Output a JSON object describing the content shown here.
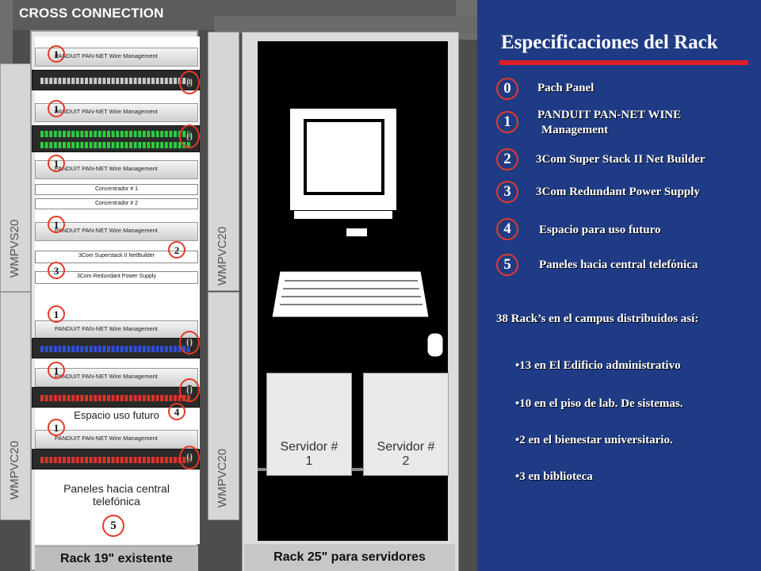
{
  "diagram": {
    "title": "CROSS CONNECTION",
    "pillar_labels": [
      "WMPVS20",
      "WMPVC20",
      "WMPVC20",
      "WMPVC20"
    ],
    "rack19": {
      "wire_mgmt_label": "PANDUIT PAN-NET Wire Management",
      "concentrators": [
        "Concentrador # 1",
        "Concentrador # 2"
      ],
      "net_builder": "3Com Superstack II NetBuilder",
      "power_supply": "3Com Redundant Power Supply",
      "future_space": "Espacio uso futuro",
      "phone_panels": "Paneles hacia central telefónica",
      "label": "Rack 19\" existente"
    },
    "rack25": {
      "label": "Rack 25\" para servidores",
      "servers": [
        {
          "line1": "Servidor #",
          "line2": "1"
        },
        {
          "line1": "Servidor #",
          "line2": "2"
        }
      ]
    },
    "markers": {
      "one": "1",
      "zero": "0",
      "two": "2",
      "three": "3",
      "four": "4",
      "five": "5"
    }
  },
  "specs": {
    "title": "Especificaciones del Rack",
    "legend": [
      {
        "num": "0",
        "text": "Pach Panel"
      },
      {
        "num": "1",
        "text": "PANDUIT PAN-NET WINE",
        "text2": "Management"
      },
      {
        "num": "2",
        "text": "3Com Super Stack II Net Builder"
      },
      {
        "num": "3",
        "text": "3Com Redundant Power Supply"
      },
      {
        "num": "4",
        "text": "Espacio para uso futuro"
      },
      {
        "num": "5",
        "text": "Paneles hacia central telefónica"
      }
    ],
    "campus_heading": "38 Rack’s en el campus distribuidos así:",
    "bullets": [
      "•13 en  El Edificio administrativo",
      "•10 en el piso de lab. De sistemas.",
      "•2 en el bienestar universitario.",
      "•3 en biblioteca"
    ]
  },
  "colors": {
    "background": "#1f3b85",
    "accent_red": "#e01e26",
    "diagram_bg": "#4d4d4d"
  }
}
